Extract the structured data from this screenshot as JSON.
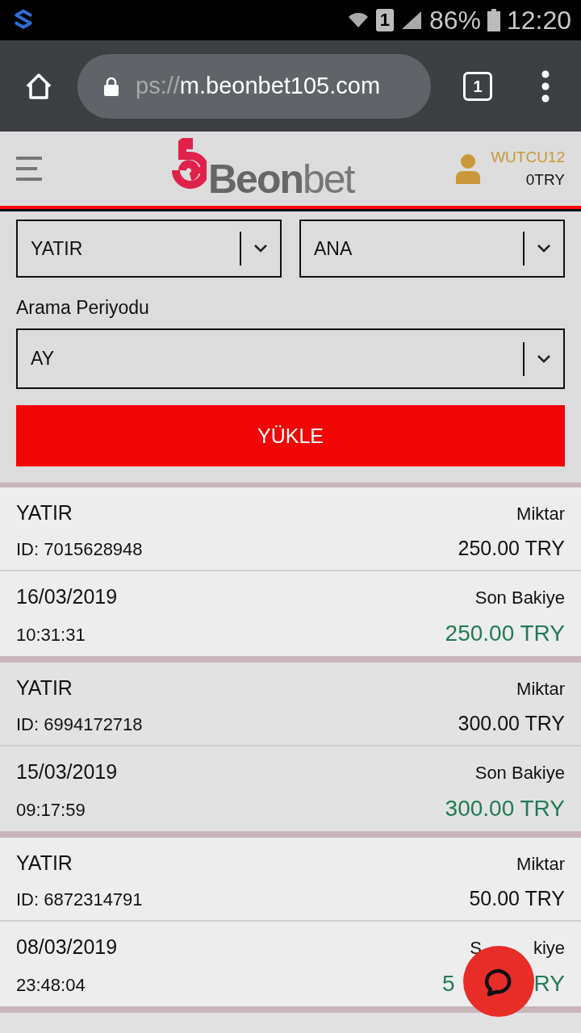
{
  "status_bar": {
    "battery": "86%",
    "time": "12:20",
    "sim": "1"
  },
  "browser": {
    "url_prefix": "ps://",
    "url": "m.beonbet105.com",
    "tab_count": "1"
  },
  "header": {
    "logo_bold": "Beon",
    "logo_light": "bet",
    "username": "WUTCU12",
    "balance": "0TRY"
  },
  "filters": {
    "selects": [
      {
        "value": "YATIR"
      },
      {
        "value": "ANA"
      }
    ],
    "period_label": "Arama Periyodu",
    "period": "AY",
    "button": "YÜKLE"
  },
  "transactions": [
    {
      "type": "YATIR",
      "id": "ID: 7015628948",
      "amount_label": "Miktar",
      "amount": "250.00 TRY",
      "date": "16/03/2019",
      "time": "10:31:31",
      "balance_label": "Son Bakiye",
      "balance": "250.00 TRY"
    },
    {
      "type": "YATIR",
      "id": "ID: 6994172718",
      "amount_label": "Miktar",
      "amount": "300.00 TRY",
      "date": "15/03/2019",
      "time": "09:17:59",
      "balance_label": "Son Bakiye",
      "balance": "300.00 TRY"
    },
    {
      "type": "YATIR",
      "id": "ID: 6872314791",
      "amount_label": "Miktar",
      "amount": "50.00 TRY",
      "date": "08/03/2019",
      "time": "23:48:04",
      "balance_label_parts": [
        "S",
        "kiye"
      ],
      "balance_parts": [
        "5",
        "RY"
      ]
    }
  ]
}
